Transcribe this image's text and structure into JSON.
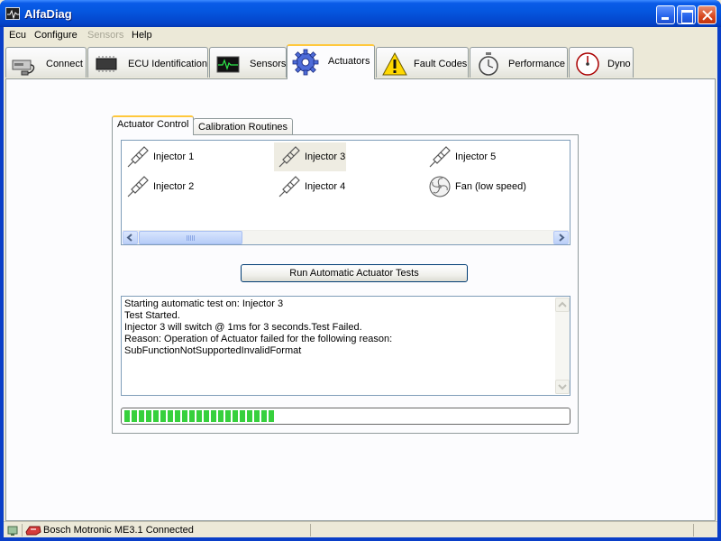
{
  "window": {
    "title": "AlfaDiag"
  },
  "menu": {
    "items": [
      {
        "label": "Ecu",
        "enabled": true
      },
      {
        "label": "Configure",
        "enabled": true
      },
      {
        "label": "Sensors",
        "enabled": false
      },
      {
        "label": "Help",
        "enabled": true
      }
    ]
  },
  "main_tabs": [
    {
      "label": "Connect",
      "icon": "connect-icon"
    },
    {
      "label": "ECU Identification",
      "icon": "chip-icon"
    },
    {
      "label": "Sensors",
      "icon": "oscilloscope-icon"
    },
    {
      "label": "Actuators",
      "icon": "gear-icon",
      "active": true
    },
    {
      "label": "Fault Codes",
      "icon": "warning-icon"
    },
    {
      "label": "Performance",
      "icon": "stopwatch-icon"
    },
    {
      "label": "Dyno",
      "icon": "gauge-icon"
    }
  ],
  "sub_tabs": [
    {
      "label": "Actuator Control",
      "active": true
    },
    {
      "label": "Calibration Routines"
    }
  ],
  "actuators": [
    {
      "label": "Injector 1",
      "icon": "injector-icon"
    },
    {
      "label": "Injector 2",
      "icon": "injector-icon"
    },
    {
      "label": "Injector 3",
      "icon": "injector-icon",
      "selected": true
    },
    {
      "label": "Injector 4",
      "icon": "injector-icon"
    },
    {
      "label": "Injector 5",
      "icon": "injector-icon"
    },
    {
      "label": "Fan (low speed)",
      "icon": "fan-icon"
    }
  ],
  "run_button": {
    "label": "Run Automatic Actuator Tests"
  },
  "log": {
    "lines": [
      "Starting automatic test on: Injector 3",
      "Test Started.",
      "Injector 3 will switch @ 1ms for 3 seconds.Test Failed.",
      "Reason: Operation of Actuator failed for the following reason:",
      "SubFunctionNotSupportedInvalidFormat"
    ]
  },
  "progress": {
    "fraction": 0.34,
    "color": "#37d03d"
  },
  "status": {
    "text": "Bosch Motronic ME3.1 Connected"
  },
  "colors": {
    "titlebar": "#0557e0",
    "tab_highlight": "#ffc83c",
    "selection": "#eeece2"
  }
}
